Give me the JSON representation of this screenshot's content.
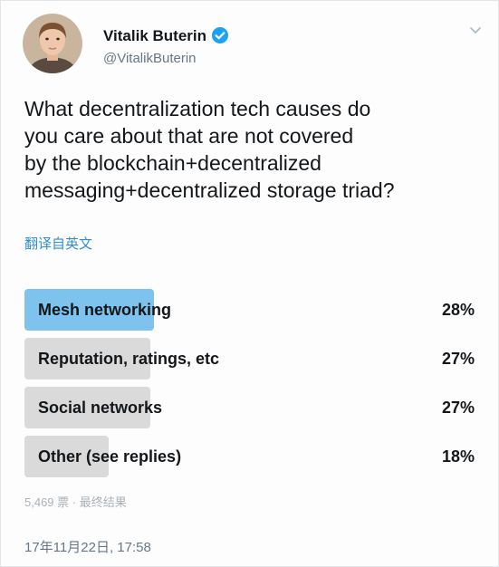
{
  "tweet": {
    "author": {
      "name": "Vitalik Buterin",
      "handle": "@VitalikButerin",
      "verified": true,
      "verified_color": "#1da1f2"
    },
    "text": "What decentralization tech causes do\nyou care about that are not covered\nby the blockchain+decentralized\nmessaging+decentralized storage triad?",
    "translate_label": "翻译自英文",
    "poll": {
      "options": [
        {
          "label": "Mesh networking",
          "percent": "28%",
          "value": 28,
          "leading": true
        },
        {
          "label": "Reputation, ratings, etc",
          "percent": "27%",
          "value": 27,
          "leading": false
        },
        {
          "label": "Social networks",
          "percent": "27%",
          "value": 27,
          "leading": false
        },
        {
          "label": "Other (see replies)",
          "percent": "18%",
          "value": 18,
          "leading": false
        }
      ],
      "meta": "5,469 票 · 最终结果",
      "leading_color": "#7ec3ee",
      "bar_color": "#dadada"
    },
    "timestamp": "17年11月22日, 17:58"
  }
}
